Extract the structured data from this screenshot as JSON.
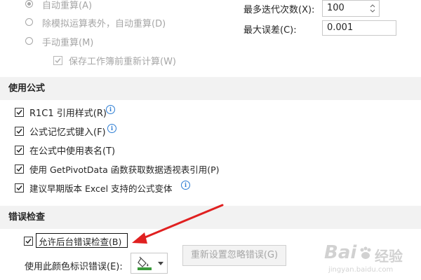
{
  "calculation": {
    "auto": "自动重算(A)",
    "auto_except_tables": "除模拟运算表外，自动重算(D)",
    "manual": "手动重算(M)",
    "recalc_before_save": "保存工作簿前重新计算(W)",
    "max_iterations_label": "最多迭代次数(X):",
    "max_iterations_value": "100",
    "max_change_label": "最大误差(C):",
    "max_change_value": "0.001"
  },
  "formulas": {
    "title": "使用公式",
    "items": [
      {
        "label": "R1C1 引用样式(R)",
        "checked": true,
        "info": true
      },
      {
        "label": "公式记忆式键入(F)",
        "checked": true,
        "info": true
      },
      {
        "label": "在公式中使用表名(T)",
        "checked": true,
        "info": false
      },
      {
        "label": "使用 GetPivotData 函数获取数据透视表引用(P)",
        "checked": true,
        "info": false
      },
      {
        "label": "建议早期版本 Excel 支持的公式变体",
        "checked": true,
        "info": true
      }
    ]
  },
  "error_checking": {
    "title": "错误检查",
    "enable_background": "允许后台错误检查(B)",
    "color_label": "使用此颜色标识错误(E):",
    "reset_button": "重新设置忽略错误(G)",
    "color_swatch": "#3a9a3a"
  },
  "watermark": {
    "brand": "Bai",
    "brand_suffix": "经验",
    "url": "jingyan.baidu.com"
  },
  "colors": {
    "annotation": "#e02020",
    "section_bg": "#f2f2f2"
  }
}
